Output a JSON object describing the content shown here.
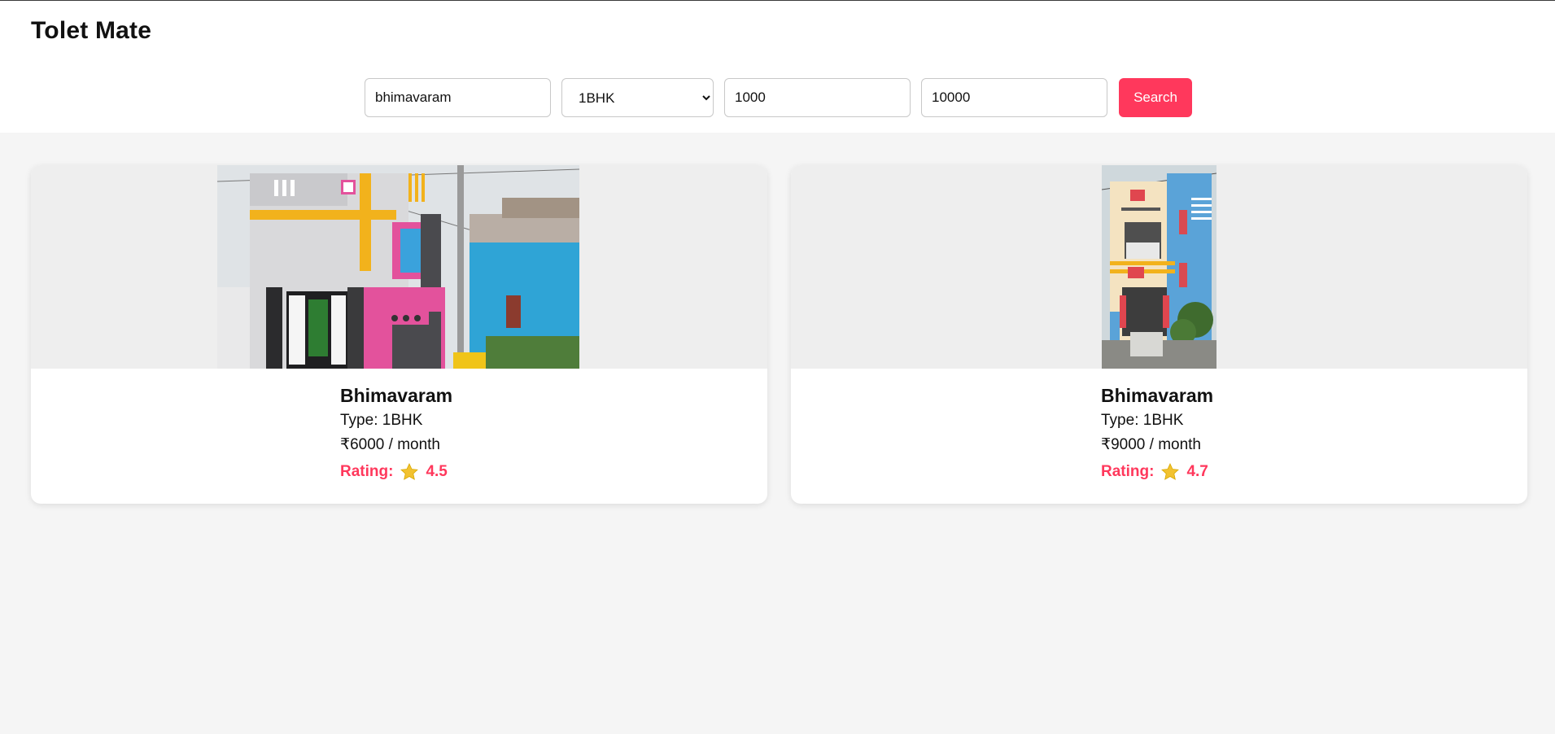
{
  "app": {
    "title": "Tolet Mate"
  },
  "search": {
    "location_value": "bhimavaram",
    "type_selected": "1BHK",
    "type_options": [
      "1BHK"
    ],
    "min_price_value": "1000",
    "max_price_value": "10000",
    "button_label": "Search"
  },
  "listings": [
    {
      "city": "Bhimavaram",
      "type": "Type: 1BHK",
      "price": "₹6000 / month",
      "rating_label": "Rating:",
      "rating_value": "4.5"
    },
    {
      "city": "Bhimavaram",
      "type": "Type: 1BHK",
      "price": "₹9000 / month",
      "rating_label": "Rating:",
      "rating_value": "4.7"
    }
  ],
  "colors": {
    "accent": "#ff385c",
    "star": "#f2c230",
    "page_bg": "#f5f5f5"
  },
  "icons": {
    "rating": "star-icon"
  }
}
